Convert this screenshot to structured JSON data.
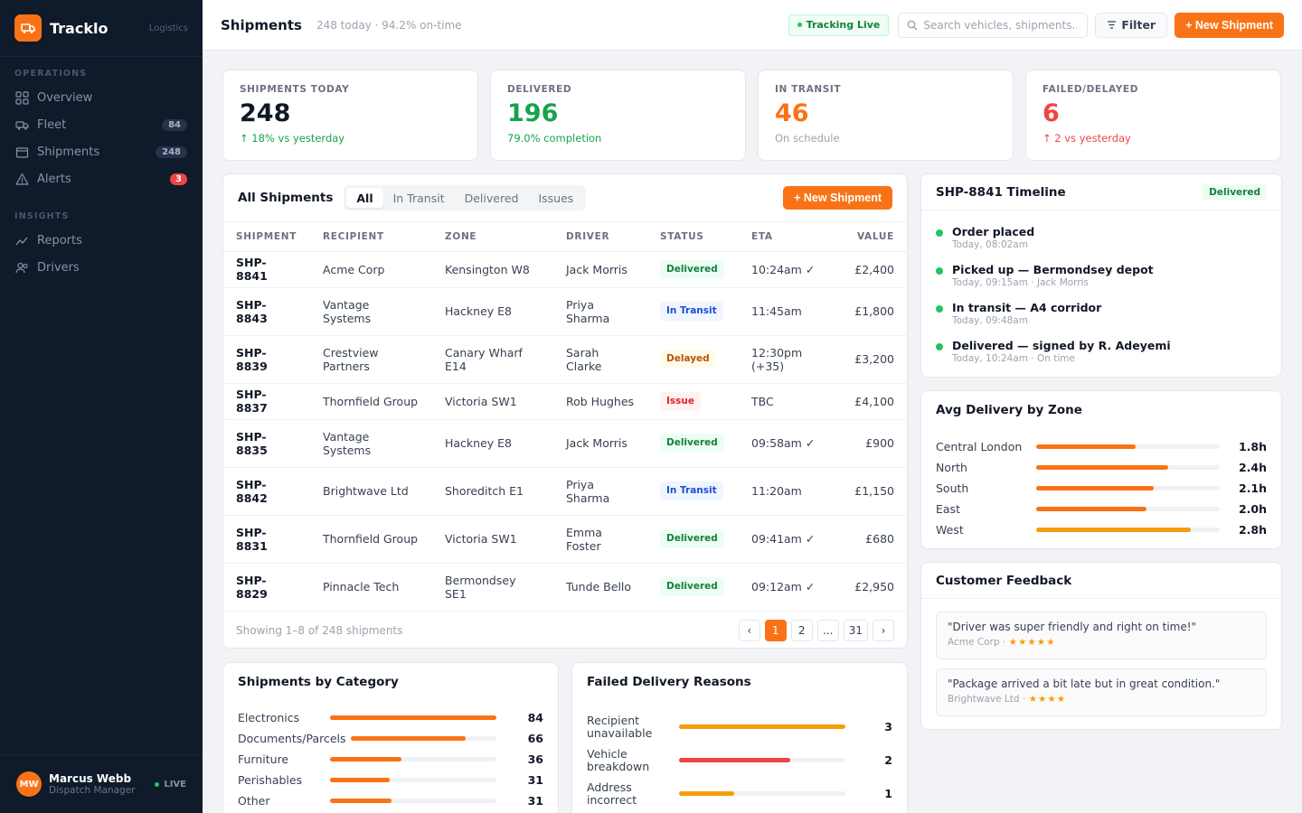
{
  "brand": {
    "name": "Tracklo",
    "tag": "Logistics"
  },
  "nav": {
    "sections": [
      {
        "label": "OPERATIONS",
        "items": [
          {
            "label": "Overview",
            "icon": "grid-icon",
            "count": ""
          },
          {
            "label": "Fleet",
            "icon": "truck-icon",
            "count": "84"
          },
          {
            "label": "Shipments",
            "icon": "package-icon",
            "count": "248"
          },
          {
            "label": "Alerts",
            "icon": "warning-icon",
            "count": "3"
          }
        ]
      },
      {
        "label": "INSIGHTS",
        "items": [
          {
            "label": "Reports",
            "icon": "chart-line-icon",
            "count": ""
          },
          {
            "label": "Drivers",
            "icon": "users-icon",
            "count": ""
          }
        ]
      }
    ]
  },
  "user": {
    "initials": "MW",
    "name": "Marcus Webb",
    "role": "Dispatch Manager",
    "status": "LIVE"
  },
  "header": {
    "title": "Shipments",
    "subtitle": "248 today · 94.2% on-time",
    "tracking": "Tracking Live",
    "search_placeholder": "Search vehicles, shipments...",
    "filter": "Filter",
    "new_shipment": "+ New Shipment"
  },
  "kpis": [
    {
      "label": "SHIPMENTS TODAY",
      "value": "248",
      "sub": "↑ 18% vs yesterday",
      "value_color": "#111827",
      "sub_color": "#16a34a"
    },
    {
      "label": "DELIVERED",
      "value": "196",
      "sub": "79.0% completion",
      "value_color": "#16a34a",
      "sub_color": "#16a34a"
    },
    {
      "label": "IN TRANSIT",
      "value": "46",
      "sub": "On schedule",
      "value_color": "#f97316",
      "sub_color": "#9ca3af"
    },
    {
      "label": "FAILED/DELAYED",
      "value": "6",
      "sub": "↑ 2 vs yesterday",
      "value_color": "#ef4444",
      "sub_color": "#ef4444"
    }
  ],
  "shipments": {
    "title": "All Shipments",
    "tabs": [
      "All",
      "In Transit",
      "Delivered",
      "Issues"
    ],
    "new_button": "+ New Shipment",
    "columns": [
      "SHIPMENT",
      "RECIPIENT",
      "ZONE",
      "DRIVER",
      "STATUS",
      "ETA",
      "VALUE"
    ],
    "rows": [
      {
        "id": "SHP-8841",
        "recipient": "Acme Corp",
        "zone": "Kensington W8",
        "driver": "Jack Morris",
        "status": "Delivered",
        "eta": "10:24am ✓",
        "value": "£2,400"
      },
      {
        "id": "SHP-8843",
        "recipient": "Vantage Systems",
        "zone": "Hackney E8",
        "driver": "Priya Sharma",
        "status": "In Transit",
        "eta": "11:45am",
        "value": "£1,800"
      },
      {
        "id": "SHP-8839",
        "recipient": "Crestview Partners",
        "zone": "Canary Wharf E14",
        "driver": "Sarah Clarke",
        "status": "Delayed",
        "eta": "12:30pm (+35)",
        "value": "£3,200"
      },
      {
        "id": "SHP-8837",
        "recipient": "Thornfield Group",
        "zone": "Victoria SW1",
        "driver": "Rob Hughes",
        "status": "Issue",
        "eta": "TBC",
        "value": "£4,100"
      },
      {
        "id": "SHP-8835",
        "recipient": "Vantage Systems",
        "zone": "Hackney E8",
        "driver": "Jack Morris",
        "status": "Delivered",
        "eta": "09:58am ✓",
        "value": "£900"
      },
      {
        "id": "SHP-8842",
        "recipient": "Brightwave Ltd",
        "zone": "Shoreditch E1",
        "driver": "Priya Sharma",
        "status": "In Transit",
        "eta": "11:20am",
        "value": "£1,150"
      },
      {
        "id": "SHP-8831",
        "recipient": "Thornfield Group",
        "zone": "Victoria SW1",
        "driver": "Emma Foster",
        "status": "Delivered",
        "eta": "09:41am ✓",
        "value": "£680"
      },
      {
        "id": "SHP-8829",
        "recipient": "Pinnacle Tech",
        "zone": "Bermondsey SE1",
        "driver": "Tunde Bello",
        "status": "Delivered",
        "eta": "09:12am ✓",
        "value": "£2,950"
      }
    ],
    "showing": "Showing 1–8 of 248 shipments",
    "pages": [
      "‹",
      "1",
      "2",
      "...",
      "31",
      "›"
    ]
  },
  "timeline": {
    "title": "SHP-8841 Timeline",
    "badge": "Delivered",
    "events": [
      {
        "title": "Order placed",
        "meta": "Today, 08:02am"
      },
      {
        "title": "Picked up — Bermondsey depot",
        "meta": "Today, 09:15am · Jack Morris"
      },
      {
        "title": "In transit — A4 corridor",
        "meta": "Today, 09:48am"
      },
      {
        "title": "Delivered — signed by R. Adeyemi",
        "meta": "Today, 10:24am · On time"
      }
    ]
  },
  "zones": {
    "title": "Avg Delivery by Zone",
    "items": [
      {
        "label": "Central London",
        "value": "1.8h",
        "fill": 0.54,
        "color": "#f97316"
      },
      {
        "label": "North",
        "value": "2.4h",
        "fill": 0.72,
        "color": "#f97316"
      },
      {
        "label": "South",
        "value": "2.1h",
        "fill": 0.64,
        "color": "#f97316"
      },
      {
        "label": "East",
        "value": "2.0h",
        "fill": 0.6,
        "color": "#f97316"
      },
      {
        "label": "West",
        "value": "2.8h",
        "fill": 0.84,
        "color": "#f59e0b"
      }
    ]
  },
  "feedback": {
    "title": "Customer Feedback",
    "items": [
      {
        "quote": "\"Driver was super friendly and right on time!\"",
        "author": "Acme Corp · ",
        "stars": "★★★★★"
      },
      {
        "quote": "\"Package arrived a bit late but in great condition.\"",
        "author": "Brightwave Ltd · ",
        "stars": "★★★★"
      }
    ]
  },
  "categories": {
    "title": "Shipments by Category",
    "items": [
      {
        "label": "Electronics",
        "value": "84",
        "fill": 1.0
      },
      {
        "label": "Documents/Parcels",
        "value": "66",
        "fill": 0.79
      },
      {
        "label": "Furniture",
        "value": "36",
        "fill": 0.43
      },
      {
        "label": "Perishables",
        "value": "31",
        "fill": 0.36
      },
      {
        "label": "Other",
        "value": "31",
        "fill": 0.37
      }
    ],
    "color": "#f97316"
  },
  "failed_reasons": {
    "title": "Failed Delivery Reasons",
    "items": [
      {
        "label": "Recipient unavailable",
        "value": "3",
        "fill": 1.0,
        "color": "#f59e0b"
      },
      {
        "label": "Vehicle breakdown",
        "value": "2",
        "fill": 0.67,
        "color": "#ef4444"
      },
      {
        "label": "Address incorrect",
        "value": "1",
        "fill": 0.33,
        "color": "#f59e0b"
      }
    ]
  }
}
